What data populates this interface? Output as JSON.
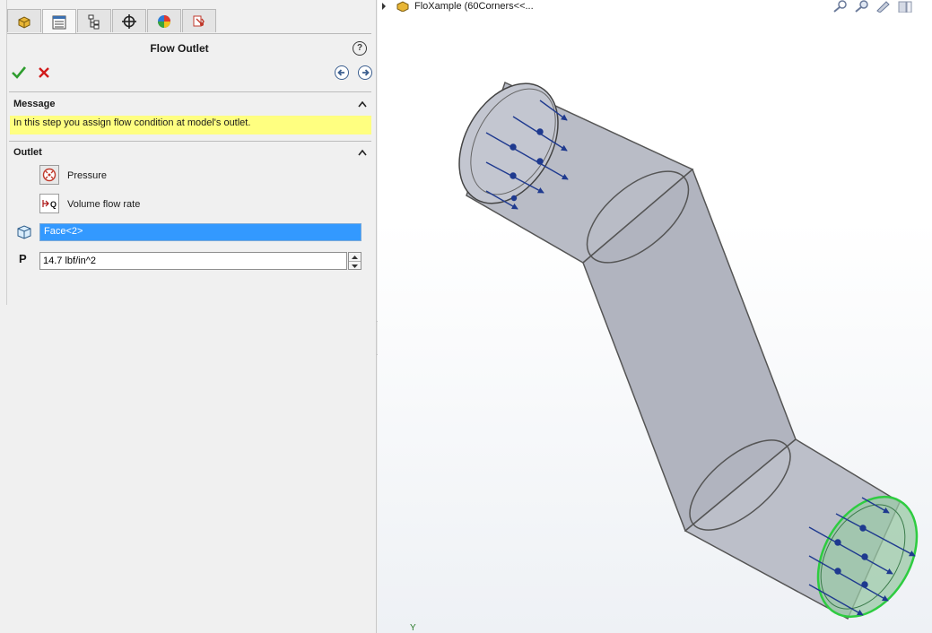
{
  "panel": {
    "tabs": [
      {
        "name": "feature-manager-tab",
        "icon": "part-icon"
      },
      {
        "name": "property-manager-tab",
        "icon": "property-list-icon",
        "active": true
      },
      {
        "name": "configuration-manager-tab",
        "icon": "configuration-tree-icon"
      },
      {
        "name": "dimxpert-tab",
        "icon": "crosshair-icon"
      },
      {
        "name": "display-manager-tab",
        "icon": "appearance-pie-icon"
      },
      {
        "name": "flow-analysis-tab",
        "icon": "flow-simulation-icon"
      }
    ],
    "title": "Flow Outlet",
    "message_header": "Message",
    "message_text": "In this step you assign flow condition at model's outlet.",
    "outlet_header": "Outlet",
    "options": [
      {
        "label": "Pressure",
        "icon": "pressure-icon",
        "selected": true
      },
      {
        "label": "Volume flow rate",
        "icon": "volume-flow-rate-icon",
        "selected": false
      }
    ],
    "face_selection": "Face<2>",
    "pressure_label": "P",
    "pressure_value": "14.7 lbf/in^2"
  },
  "viewport": {
    "tree_flyout_label": "FloXample  (60Corners<<...",
    "axis_label": "Y"
  },
  "colors": {
    "selection_blue": "#3399ff",
    "message_yellow": "#ffff80",
    "pipe_fill": "#b9bcc6",
    "outlet_face": "#9ac8a6",
    "outlet_edge": "#2ecc40",
    "arrow_blue": "#1f3a8f"
  }
}
